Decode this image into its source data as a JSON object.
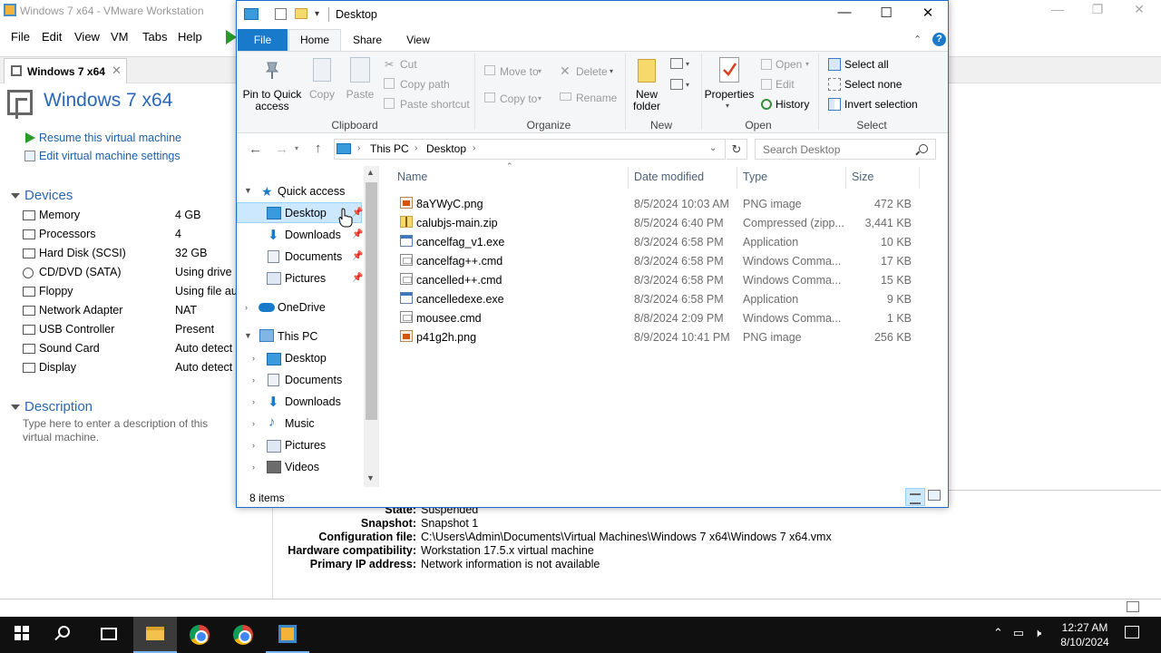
{
  "vmware": {
    "window_title": "Windows 7 x64 - VMware Workstation",
    "menu": [
      "File",
      "Edit",
      "View",
      "VM",
      "Tabs",
      "Help"
    ],
    "tab_label": "Windows 7 x64",
    "tab_close": "✕",
    "vm_name": "Windows 7 x64",
    "actions": {
      "resume": "Resume this virtual machine",
      "edit_settings": "Edit virtual machine settings"
    },
    "devices_title": "Devices",
    "devices": [
      {
        "name": "Memory",
        "value": "4 GB"
      },
      {
        "name": "Processors",
        "value": "4"
      },
      {
        "name": "Hard Disk (SCSI)",
        "value": "32 GB"
      },
      {
        "name": "CD/DVD (SATA)",
        "value": "Using drive E"
      },
      {
        "name": "Floppy",
        "value": "Using file aut"
      },
      {
        "name": "Network Adapter",
        "value": "NAT"
      },
      {
        "name": "USB Controller",
        "value": "Present"
      },
      {
        "name": "Sound Card",
        "value": "Auto detect"
      },
      {
        "name": "Display",
        "value": "Auto detect"
      }
    ],
    "description_title": "Description",
    "description_placeholder": "Type here to enter a description of this virtual machine.",
    "details": [
      {
        "key": "State:",
        "value": "Suspended"
      },
      {
        "key": "Snapshot:",
        "value": "Snapshot 1"
      },
      {
        "key": "Configuration file:",
        "value": "C:\\Users\\Admin\\Documents\\Virtual Machines\\Windows 7 x64\\Windows 7 x64.vmx"
      },
      {
        "key": "Hardware compatibility:",
        "value": "Workstation 17.5.x virtual machine"
      },
      {
        "key": "Primary IP address:",
        "value": "Network information is not available"
      }
    ]
  },
  "explorer": {
    "title": "Desktop",
    "qat_dropdown": "▾",
    "tabs": {
      "file": "File",
      "home": "Home",
      "share": "Share",
      "view": "View"
    },
    "help": "?",
    "ribbon": {
      "pin": "Pin to Quick access",
      "copy": "Copy",
      "paste": "Paste",
      "cut": "Cut",
      "copy_path": "Copy path",
      "paste_shortcut": "Paste shortcut",
      "clipboard": "Clipboard",
      "move_to": "Move to",
      "copy_to": "Copy to",
      "delete": "Delete",
      "rename": "Rename",
      "organize": "Organize",
      "new_folder": "New folder",
      "new": "New",
      "properties": "Properties",
      "open": "Open",
      "edit": "Edit",
      "history": "History",
      "open_group": "Open",
      "select_all": "Select all",
      "select_none": "Select none",
      "invert_selection": "Invert selection",
      "select": "Select"
    },
    "address": {
      "this_pc": "This PC",
      "desktop": "Desktop"
    },
    "search_placeholder": "Search Desktop",
    "nav": {
      "quick_access": "Quick access",
      "qa_items": [
        "Desktop",
        "Downloads",
        "Documents",
        "Pictures"
      ],
      "onedrive": "OneDrive",
      "this_pc": "This PC",
      "pc_items": [
        "Desktop",
        "Documents",
        "Downloads",
        "Music",
        "Pictures",
        "Videos"
      ]
    },
    "columns": {
      "name": "Name",
      "date": "Date modified",
      "type": "Type",
      "size": "Size"
    },
    "files": [
      {
        "name": "8aYWyC.png",
        "date": "8/5/2024 10:03 AM",
        "type": "PNG image",
        "size": "472 KB",
        "icon": "png"
      },
      {
        "name": "calubjs-main.zip",
        "date": "8/5/2024 6:40 PM",
        "type": "Compressed (zipp...",
        "size": "3,441 KB",
        "icon": "zip"
      },
      {
        "name": "cancelfag_v1.exe",
        "date": "8/3/2024 6:58 PM",
        "type": "Application",
        "size": "10 KB",
        "icon": "exe"
      },
      {
        "name": "cancelfag++.cmd",
        "date": "8/3/2024 6:58 PM",
        "type": "Windows Comma...",
        "size": "17 KB",
        "icon": "cmd"
      },
      {
        "name": "cancelled++.cmd",
        "date": "8/3/2024 6:58 PM",
        "type": "Windows Comma...",
        "size": "15 KB",
        "icon": "cmd"
      },
      {
        "name": "cancelledexe.exe",
        "date": "8/3/2024 6:58 PM",
        "type": "Application",
        "size": "9 KB",
        "icon": "exe"
      },
      {
        "name": "mousee.cmd",
        "date": "8/8/2024 2:09 PM",
        "type": "Windows Comma...",
        "size": "1 KB",
        "icon": "cmd"
      },
      {
        "name": "p41g2h.png",
        "date": "8/9/2024 10:41 PM",
        "type": "PNG image",
        "size": "256 KB",
        "icon": "png"
      }
    ],
    "status_count": "8 items"
  },
  "taskbar": {
    "time": "12:27 AM",
    "date": "8/10/2024"
  },
  "colors": {
    "accent": "#1979ca",
    "vm_blue": "#2a67b5",
    "selection": "#cce8ff"
  }
}
